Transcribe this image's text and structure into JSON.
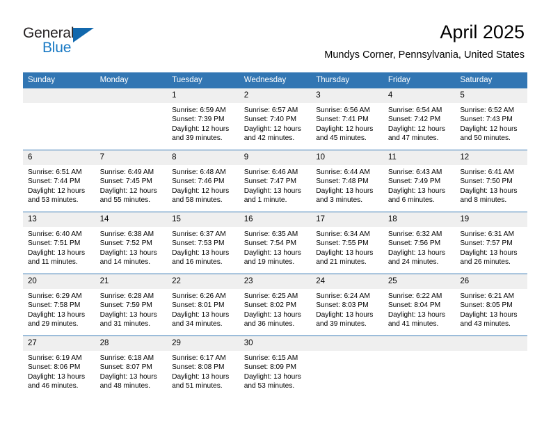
{
  "brand": {
    "name_part1": "General",
    "name_part2": "Blue",
    "triangle_color": "#1268ad",
    "blue_color": "#1879c4"
  },
  "header": {
    "title": "April 2025",
    "subtitle": "Mundys Corner, Pennsylvania, United States"
  },
  "theme": {
    "header_blue": "#3276b3",
    "daynum_gray": "#efefef",
    "text_black": "#000000"
  },
  "calendar": {
    "weekday_headers": [
      "Sunday",
      "Monday",
      "Tuesday",
      "Wednesday",
      "Thursday",
      "Friday",
      "Saturday"
    ],
    "weeks": [
      [
        {
          "day": "",
          "empty": true
        },
        {
          "day": "",
          "empty": true
        },
        {
          "day": "1",
          "sunrise": "Sunrise: 6:59 AM",
          "sunset": "Sunset: 7:39 PM",
          "daylight": "Daylight: 12 hours and 39 minutes."
        },
        {
          "day": "2",
          "sunrise": "Sunrise: 6:57 AM",
          "sunset": "Sunset: 7:40 PM",
          "daylight": "Daylight: 12 hours and 42 minutes."
        },
        {
          "day": "3",
          "sunrise": "Sunrise: 6:56 AM",
          "sunset": "Sunset: 7:41 PM",
          "daylight": "Daylight: 12 hours and 45 minutes."
        },
        {
          "day": "4",
          "sunrise": "Sunrise: 6:54 AM",
          "sunset": "Sunset: 7:42 PM",
          "daylight": "Daylight: 12 hours and 47 minutes."
        },
        {
          "day": "5",
          "sunrise": "Sunrise: 6:52 AM",
          "sunset": "Sunset: 7:43 PM",
          "daylight": "Daylight: 12 hours and 50 minutes."
        }
      ],
      [
        {
          "day": "6",
          "sunrise": "Sunrise: 6:51 AM",
          "sunset": "Sunset: 7:44 PM",
          "daylight": "Daylight: 12 hours and 53 minutes."
        },
        {
          "day": "7",
          "sunrise": "Sunrise: 6:49 AM",
          "sunset": "Sunset: 7:45 PM",
          "daylight": "Daylight: 12 hours and 55 minutes."
        },
        {
          "day": "8",
          "sunrise": "Sunrise: 6:48 AM",
          "sunset": "Sunset: 7:46 PM",
          "daylight": "Daylight: 12 hours and 58 minutes."
        },
        {
          "day": "9",
          "sunrise": "Sunrise: 6:46 AM",
          "sunset": "Sunset: 7:47 PM",
          "daylight": "Daylight: 13 hours and 1 minute."
        },
        {
          "day": "10",
          "sunrise": "Sunrise: 6:44 AM",
          "sunset": "Sunset: 7:48 PM",
          "daylight": "Daylight: 13 hours and 3 minutes."
        },
        {
          "day": "11",
          "sunrise": "Sunrise: 6:43 AM",
          "sunset": "Sunset: 7:49 PM",
          "daylight": "Daylight: 13 hours and 6 minutes."
        },
        {
          "day": "12",
          "sunrise": "Sunrise: 6:41 AM",
          "sunset": "Sunset: 7:50 PM",
          "daylight": "Daylight: 13 hours and 8 minutes."
        }
      ],
      [
        {
          "day": "13",
          "sunrise": "Sunrise: 6:40 AM",
          "sunset": "Sunset: 7:51 PM",
          "daylight": "Daylight: 13 hours and 11 minutes."
        },
        {
          "day": "14",
          "sunrise": "Sunrise: 6:38 AM",
          "sunset": "Sunset: 7:52 PM",
          "daylight": "Daylight: 13 hours and 14 minutes."
        },
        {
          "day": "15",
          "sunrise": "Sunrise: 6:37 AM",
          "sunset": "Sunset: 7:53 PM",
          "daylight": "Daylight: 13 hours and 16 minutes."
        },
        {
          "day": "16",
          "sunrise": "Sunrise: 6:35 AM",
          "sunset": "Sunset: 7:54 PM",
          "daylight": "Daylight: 13 hours and 19 minutes."
        },
        {
          "day": "17",
          "sunrise": "Sunrise: 6:34 AM",
          "sunset": "Sunset: 7:55 PM",
          "daylight": "Daylight: 13 hours and 21 minutes."
        },
        {
          "day": "18",
          "sunrise": "Sunrise: 6:32 AM",
          "sunset": "Sunset: 7:56 PM",
          "daylight": "Daylight: 13 hours and 24 minutes."
        },
        {
          "day": "19",
          "sunrise": "Sunrise: 6:31 AM",
          "sunset": "Sunset: 7:57 PM",
          "daylight": "Daylight: 13 hours and 26 minutes."
        }
      ],
      [
        {
          "day": "20",
          "sunrise": "Sunrise: 6:29 AM",
          "sunset": "Sunset: 7:58 PM",
          "daylight": "Daylight: 13 hours and 29 minutes."
        },
        {
          "day": "21",
          "sunrise": "Sunrise: 6:28 AM",
          "sunset": "Sunset: 7:59 PM",
          "daylight": "Daylight: 13 hours and 31 minutes."
        },
        {
          "day": "22",
          "sunrise": "Sunrise: 6:26 AM",
          "sunset": "Sunset: 8:01 PM",
          "daylight": "Daylight: 13 hours and 34 minutes."
        },
        {
          "day": "23",
          "sunrise": "Sunrise: 6:25 AM",
          "sunset": "Sunset: 8:02 PM",
          "daylight": "Daylight: 13 hours and 36 minutes."
        },
        {
          "day": "24",
          "sunrise": "Sunrise: 6:24 AM",
          "sunset": "Sunset: 8:03 PM",
          "daylight": "Daylight: 13 hours and 39 minutes."
        },
        {
          "day": "25",
          "sunrise": "Sunrise: 6:22 AM",
          "sunset": "Sunset: 8:04 PM",
          "daylight": "Daylight: 13 hours and 41 minutes."
        },
        {
          "day": "26",
          "sunrise": "Sunrise: 6:21 AM",
          "sunset": "Sunset: 8:05 PM",
          "daylight": "Daylight: 13 hours and 43 minutes."
        }
      ],
      [
        {
          "day": "27",
          "sunrise": "Sunrise: 6:19 AM",
          "sunset": "Sunset: 8:06 PM",
          "daylight": "Daylight: 13 hours and 46 minutes."
        },
        {
          "day": "28",
          "sunrise": "Sunrise: 6:18 AM",
          "sunset": "Sunset: 8:07 PM",
          "daylight": "Daylight: 13 hours and 48 minutes."
        },
        {
          "day": "29",
          "sunrise": "Sunrise: 6:17 AM",
          "sunset": "Sunset: 8:08 PM",
          "daylight": "Daylight: 13 hours and 51 minutes."
        },
        {
          "day": "30",
          "sunrise": "Sunrise: 6:15 AM",
          "sunset": "Sunset: 8:09 PM",
          "daylight": "Daylight: 13 hours and 53 minutes."
        },
        {
          "day": "",
          "empty": true
        },
        {
          "day": "",
          "empty": true
        },
        {
          "day": "",
          "empty": true
        }
      ]
    ]
  }
}
